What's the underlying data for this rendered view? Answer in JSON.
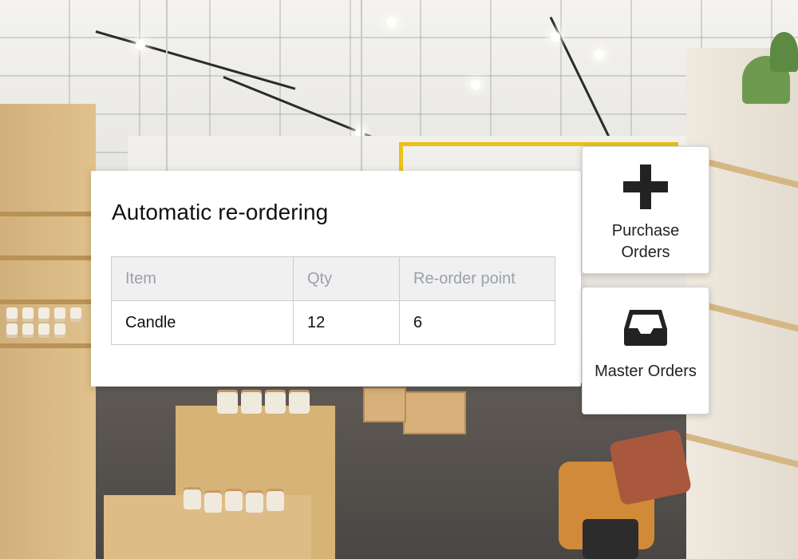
{
  "panel": {
    "title": "Automatic re-ordering",
    "table": {
      "headers": [
        "Item",
        "Qty",
        "Re-order point"
      ],
      "rows": [
        [
          "Candle",
          "12",
          "6"
        ]
      ]
    }
  },
  "actions": [
    {
      "label": "Purchase Orders",
      "icon": "plus-icon"
    },
    {
      "label": "Master Orders",
      "icon": "inbox-tray-icon"
    }
  ],
  "colors": {
    "header_text": "#9aa1a9",
    "header_bg": "#f0f0f1",
    "icon": "#222222"
  }
}
